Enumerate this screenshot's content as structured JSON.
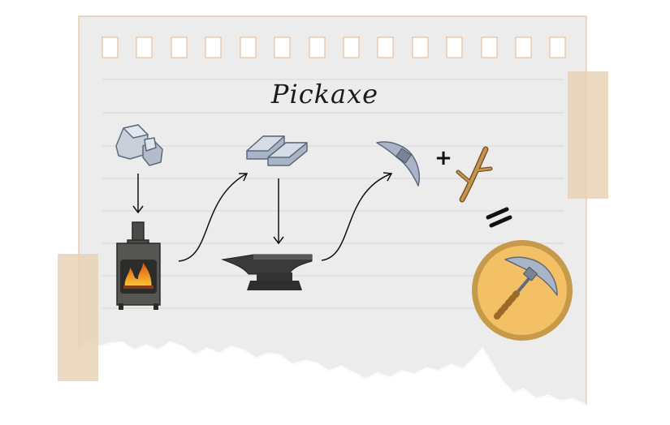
{
  "title": "Pickaxe",
  "operators": {
    "plus": "+",
    "equals": "="
  },
  "icons": [
    "stone-icon",
    "iron-ingots-icon",
    "furnace-icon",
    "anvil-icon",
    "pickaxe-head-icon",
    "stick-icon",
    "pickaxe-icon"
  ],
  "colors": {
    "paper": "#ececec",
    "paper_border": "#e6b48a",
    "ruled_line": "#d6d6d6",
    "tape": "#e8d3b6",
    "badge_fill": "#f3c066",
    "badge_ring": "#c79a4a",
    "metal": "#a9b4c6",
    "dark_metal": "#3a3a3a",
    "wood": "#b8873f",
    "fire": "#f08a1c"
  }
}
